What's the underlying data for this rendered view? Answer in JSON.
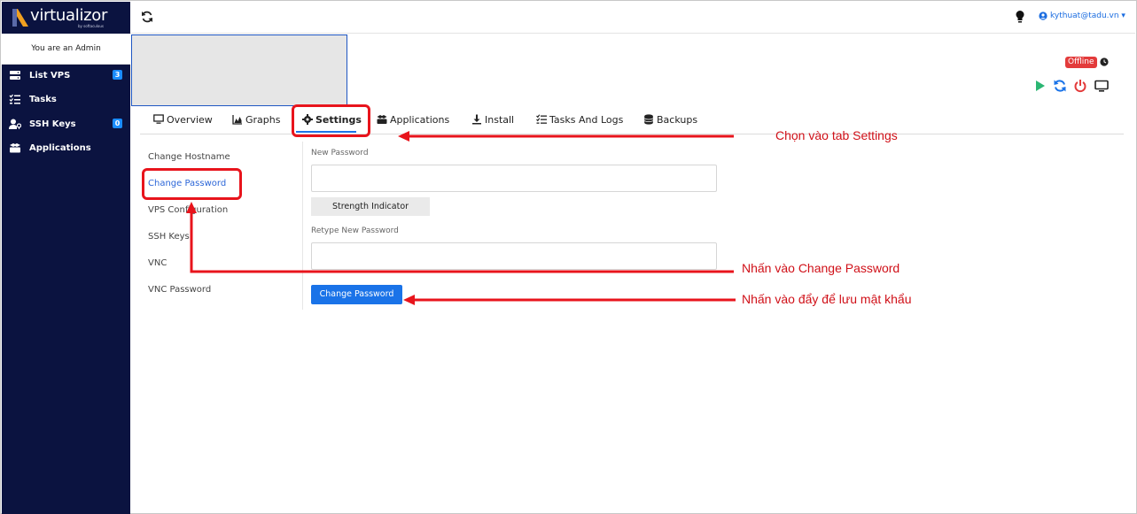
{
  "brand": {
    "name": "virtualizor",
    "sub": "by softaculous"
  },
  "sidebar": {
    "admin_text": "You are an Admin",
    "items": [
      {
        "label": "List VPS",
        "badge": "3",
        "icon": "server-icon"
      },
      {
        "label": "Tasks",
        "badge": "",
        "icon": "tasks-icon"
      },
      {
        "label": "SSH Keys",
        "badge": "0",
        "icon": "user-key-icon"
      },
      {
        "label": "Applications",
        "badge": "",
        "icon": "boxes-icon"
      }
    ]
  },
  "topbar": {
    "user": "kythuat@tadu.vn ▾"
  },
  "status": {
    "label": "Offline"
  },
  "tabs": [
    {
      "label": "Overview",
      "icon": "monitor-icon"
    },
    {
      "label": "Graphs",
      "icon": "chart-icon"
    },
    {
      "label": "Settings",
      "icon": "gear-icon"
    },
    {
      "label": "Applications",
      "icon": "boxes-icon"
    },
    {
      "label": "Install",
      "icon": "download-icon"
    },
    {
      "label": "Tasks And Logs",
      "icon": "tasks-icon"
    },
    {
      "label": "Backups",
      "icon": "database-icon"
    }
  ],
  "settings_menu": [
    "Change Hostname",
    "Change Password",
    "VPS Configuration",
    "SSH Keys",
    "VNC",
    "VNC Password"
  ],
  "form": {
    "new_password_label": "New Password",
    "strength_label": "Strength Indicator",
    "retype_label": "Retype New Password",
    "submit_label": "Change Password"
  },
  "annotations": {
    "tab_note": "Chọn vào tab Settings",
    "menu_note": "Nhấn vào Change Password",
    "button_note": "Nhấn vào đẩy để lưu mật khẩu"
  },
  "colors": {
    "sidebar": "#0b1340",
    "accent": "#1a73e8",
    "annotation": "#e8141c",
    "offline": "#e33b3b"
  }
}
